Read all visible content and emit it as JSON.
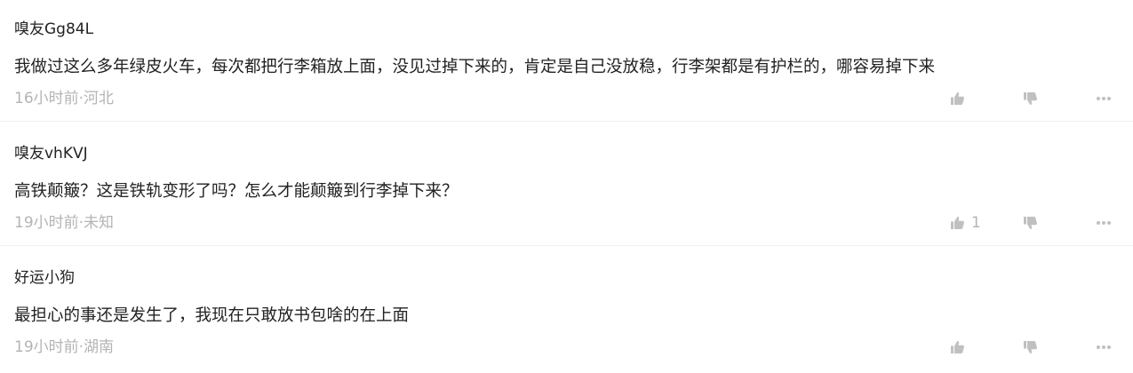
{
  "comments": [
    {
      "username": "嗅友Gg84L",
      "content": "我做过这么多年绿皮火车，每次都把行李箱放上面，没见过掉下来的，肯定是自己没放稳，行李架都是有护栏的，哪容易掉下来",
      "meta": "16小时前·河北",
      "likes": ""
    },
    {
      "username": "嗅友vhKVJ",
      "content": "高铁颠簸？这是铁轨变形了吗？怎么才能颠簸到行李掉下来？",
      "meta": "19小时前·未知",
      "likes": "1"
    },
    {
      "username": "好运小狗",
      "content": "最担心的事还是发生了，我现在只敢放书包啥的在上面",
      "meta": "19小时前·湖南",
      "likes": ""
    }
  ],
  "icons": {
    "like": "thumbs-up-icon",
    "dislike": "thumbs-down-icon",
    "more": "more-dots-icon"
  },
  "colors": {
    "text": "#222222",
    "meta": "#b4b4b4",
    "icon": "#c0c0c0",
    "divider": "#f0f0f0"
  }
}
